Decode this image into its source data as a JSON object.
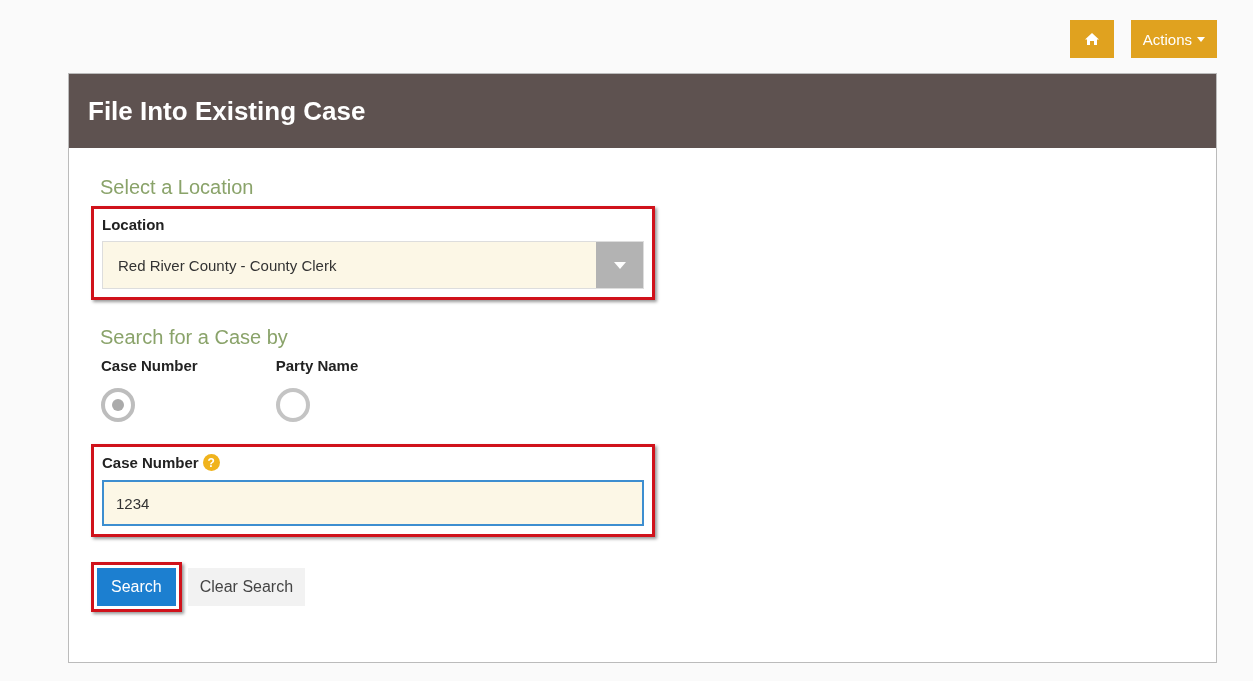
{
  "toolbar": {
    "actions_label": "Actions"
  },
  "panel": {
    "title": "File Into Existing Case"
  },
  "location_section": {
    "heading": "Select a Location",
    "highlighted": true,
    "label": "Location",
    "value": "Red River County - County Clerk"
  },
  "search_section": {
    "heading": "Search for a Case by",
    "options": [
      {
        "label": "Case Number",
        "selected": true
      },
      {
        "label": "Party Name",
        "selected": false
      }
    ]
  },
  "case_field": {
    "highlighted": true,
    "label": "Case Number",
    "help": "?",
    "value": "1234"
  },
  "buttons": [
    {
      "label": "Search",
      "kind": "primary",
      "highlighted": true
    },
    {
      "label": "Clear Search",
      "kind": "secondary",
      "highlighted": false
    }
  ]
}
